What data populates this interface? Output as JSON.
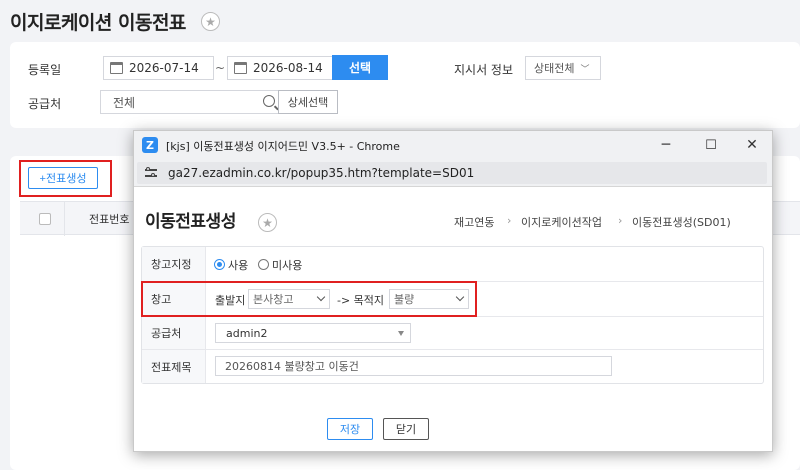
{
  "page": {
    "title": "이지로케이션 이동전표",
    "favorite_icon": "star-icon"
  },
  "filters": {
    "reg_date_label": "등록일",
    "date_from": "2026-07-14",
    "date_sep": "~",
    "date_to": "2026-08-14",
    "select_button": "선택",
    "instruction_label": "지시서 정보",
    "status_select": "상태전체",
    "supplier_label": "공급처",
    "supplier_value": "전체",
    "detail_select_button": "상세선택"
  },
  "list": {
    "create_button": "+전표생성",
    "columns": [
      "전표번호"
    ]
  },
  "popup": {
    "window_title": "[kjs] 이동전표생성 이지어드민 V3.5+ - Chrome",
    "controls": {
      "minimize": "─",
      "maximize": "☐",
      "close": "✕"
    },
    "url": "ga27.ezadmin.co.kr/popup35.htm?template=SD01",
    "heading": "이동전표생성",
    "breadcrumb": [
      "재고연동",
      "이지로케이션작업",
      "이동전표생성(SD01)"
    ],
    "breadcrumb_sep": "›",
    "form": {
      "warehouse_assign_label": "창고지정",
      "radio_use": "사용",
      "radio_nouse": "미사용",
      "radio_use_selected": true,
      "warehouse_label": "창고",
      "origin_label": "출발지",
      "origin_value": "본사창고",
      "dest_label": "-> 목적지",
      "dest_value": "불량",
      "supplier_label": "공급처",
      "supplier_value": "admin2",
      "slip_title_label": "전표제목",
      "slip_title_value": "20260814 불량창고 이동건"
    },
    "save_button": "저장",
    "close_button": "닫기"
  },
  "colors": {
    "accent": "#2d8cf0",
    "highlight_border": "#e02020"
  }
}
